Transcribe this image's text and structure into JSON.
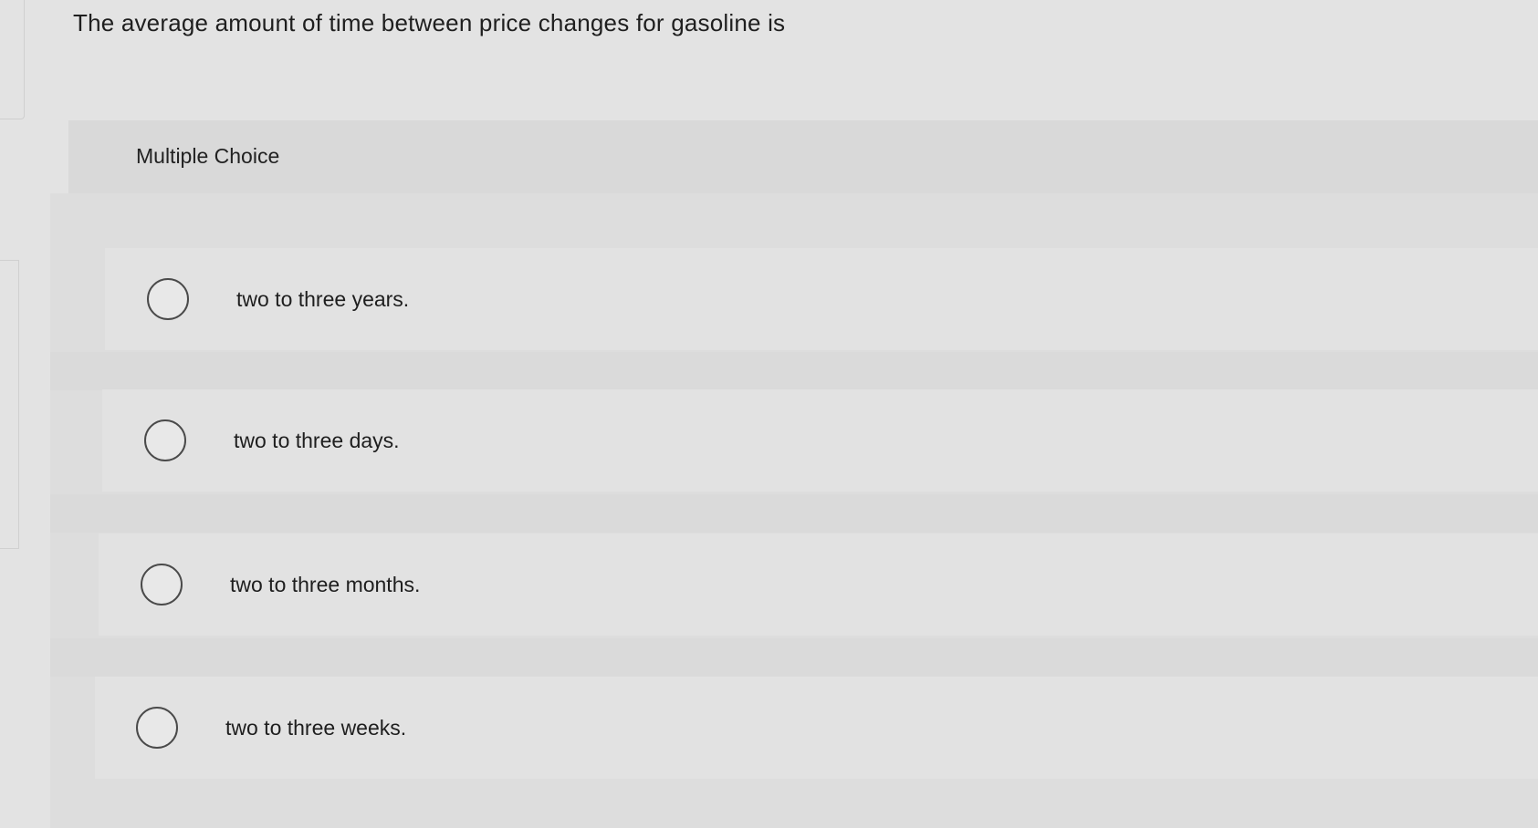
{
  "question": {
    "text": "The average amount of time between price changes for gasoline is"
  },
  "section": {
    "label": "Multiple Choice"
  },
  "options": [
    {
      "label": "two to three years."
    },
    {
      "label": "two to three days."
    },
    {
      "label": "two to three months."
    },
    {
      "label": "two to three weeks."
    }
  ]
}
